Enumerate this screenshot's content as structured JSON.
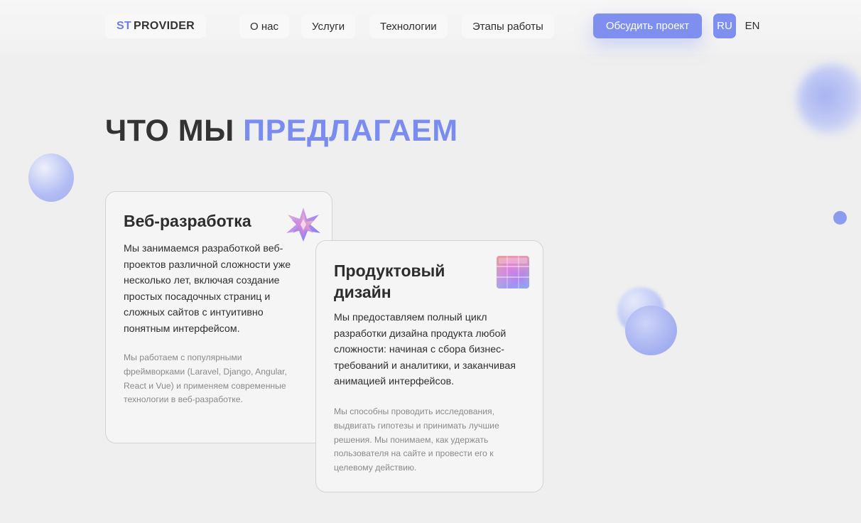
{
  "header": {
    "logo": {
      "prefix": "ST",
      "name": "PROVIDER"
    },
    "nav": [
      {
        "label": "О нас"
      },
      {
        "label": "Услуги"
      },
      {
        "label": "Технологии"
      },
      {
        "label": "Этапы работы"
      }
    ],
    "cta_label": "Обсудить проект",
    "languages": [
      {
        "label": "RU",
        "active": true
      },
      {
        "label": "EN",
        "active": false
      }
    ]
  },
  "section": {
    "title_dark": "ЧТО МЫ",
    "title_accent": "ПРЕДЛАГАЕМ"
  },
  "cards": [
    {
      "title": "Веб-разработка",
      "icon": "star-polyhedron-icon",
      "text": "Мы занимаемся разработкой веб-проектов различной сложности уже несколько лет, включая создание простых посадочных страниц и сложных сайтов с интуитивно понятным интерфейсом.",
      "note": "Мы работаем с популярными фреймворками (Laravel, Django, Angular, React и Vue) и применяем современные технологии в веб-разработке."
    },
    {
      "title": "Продуктовый дизайн",
      "icon": "glass-cube-icon",
      "text": "Мы предоставляем полный цикл разработки дизайна продукта любой сложности: начиная с сбора бизнес-требований и аналитики, и заканчивая анимацией интерфейсов.",
      "note": "Мы способны проводить исследования, выдвигать гипотезы и принимать лучшие решения. Мы понимаем, как удержать пользователя на сайте и провести его к целевому действию."
    }
  ],
  "colors": {
    "accent": "#7b8cf1",
    "button": "#7f8ff0",
    "background": "#efefef",
    "text": "#333333"
  }
}
